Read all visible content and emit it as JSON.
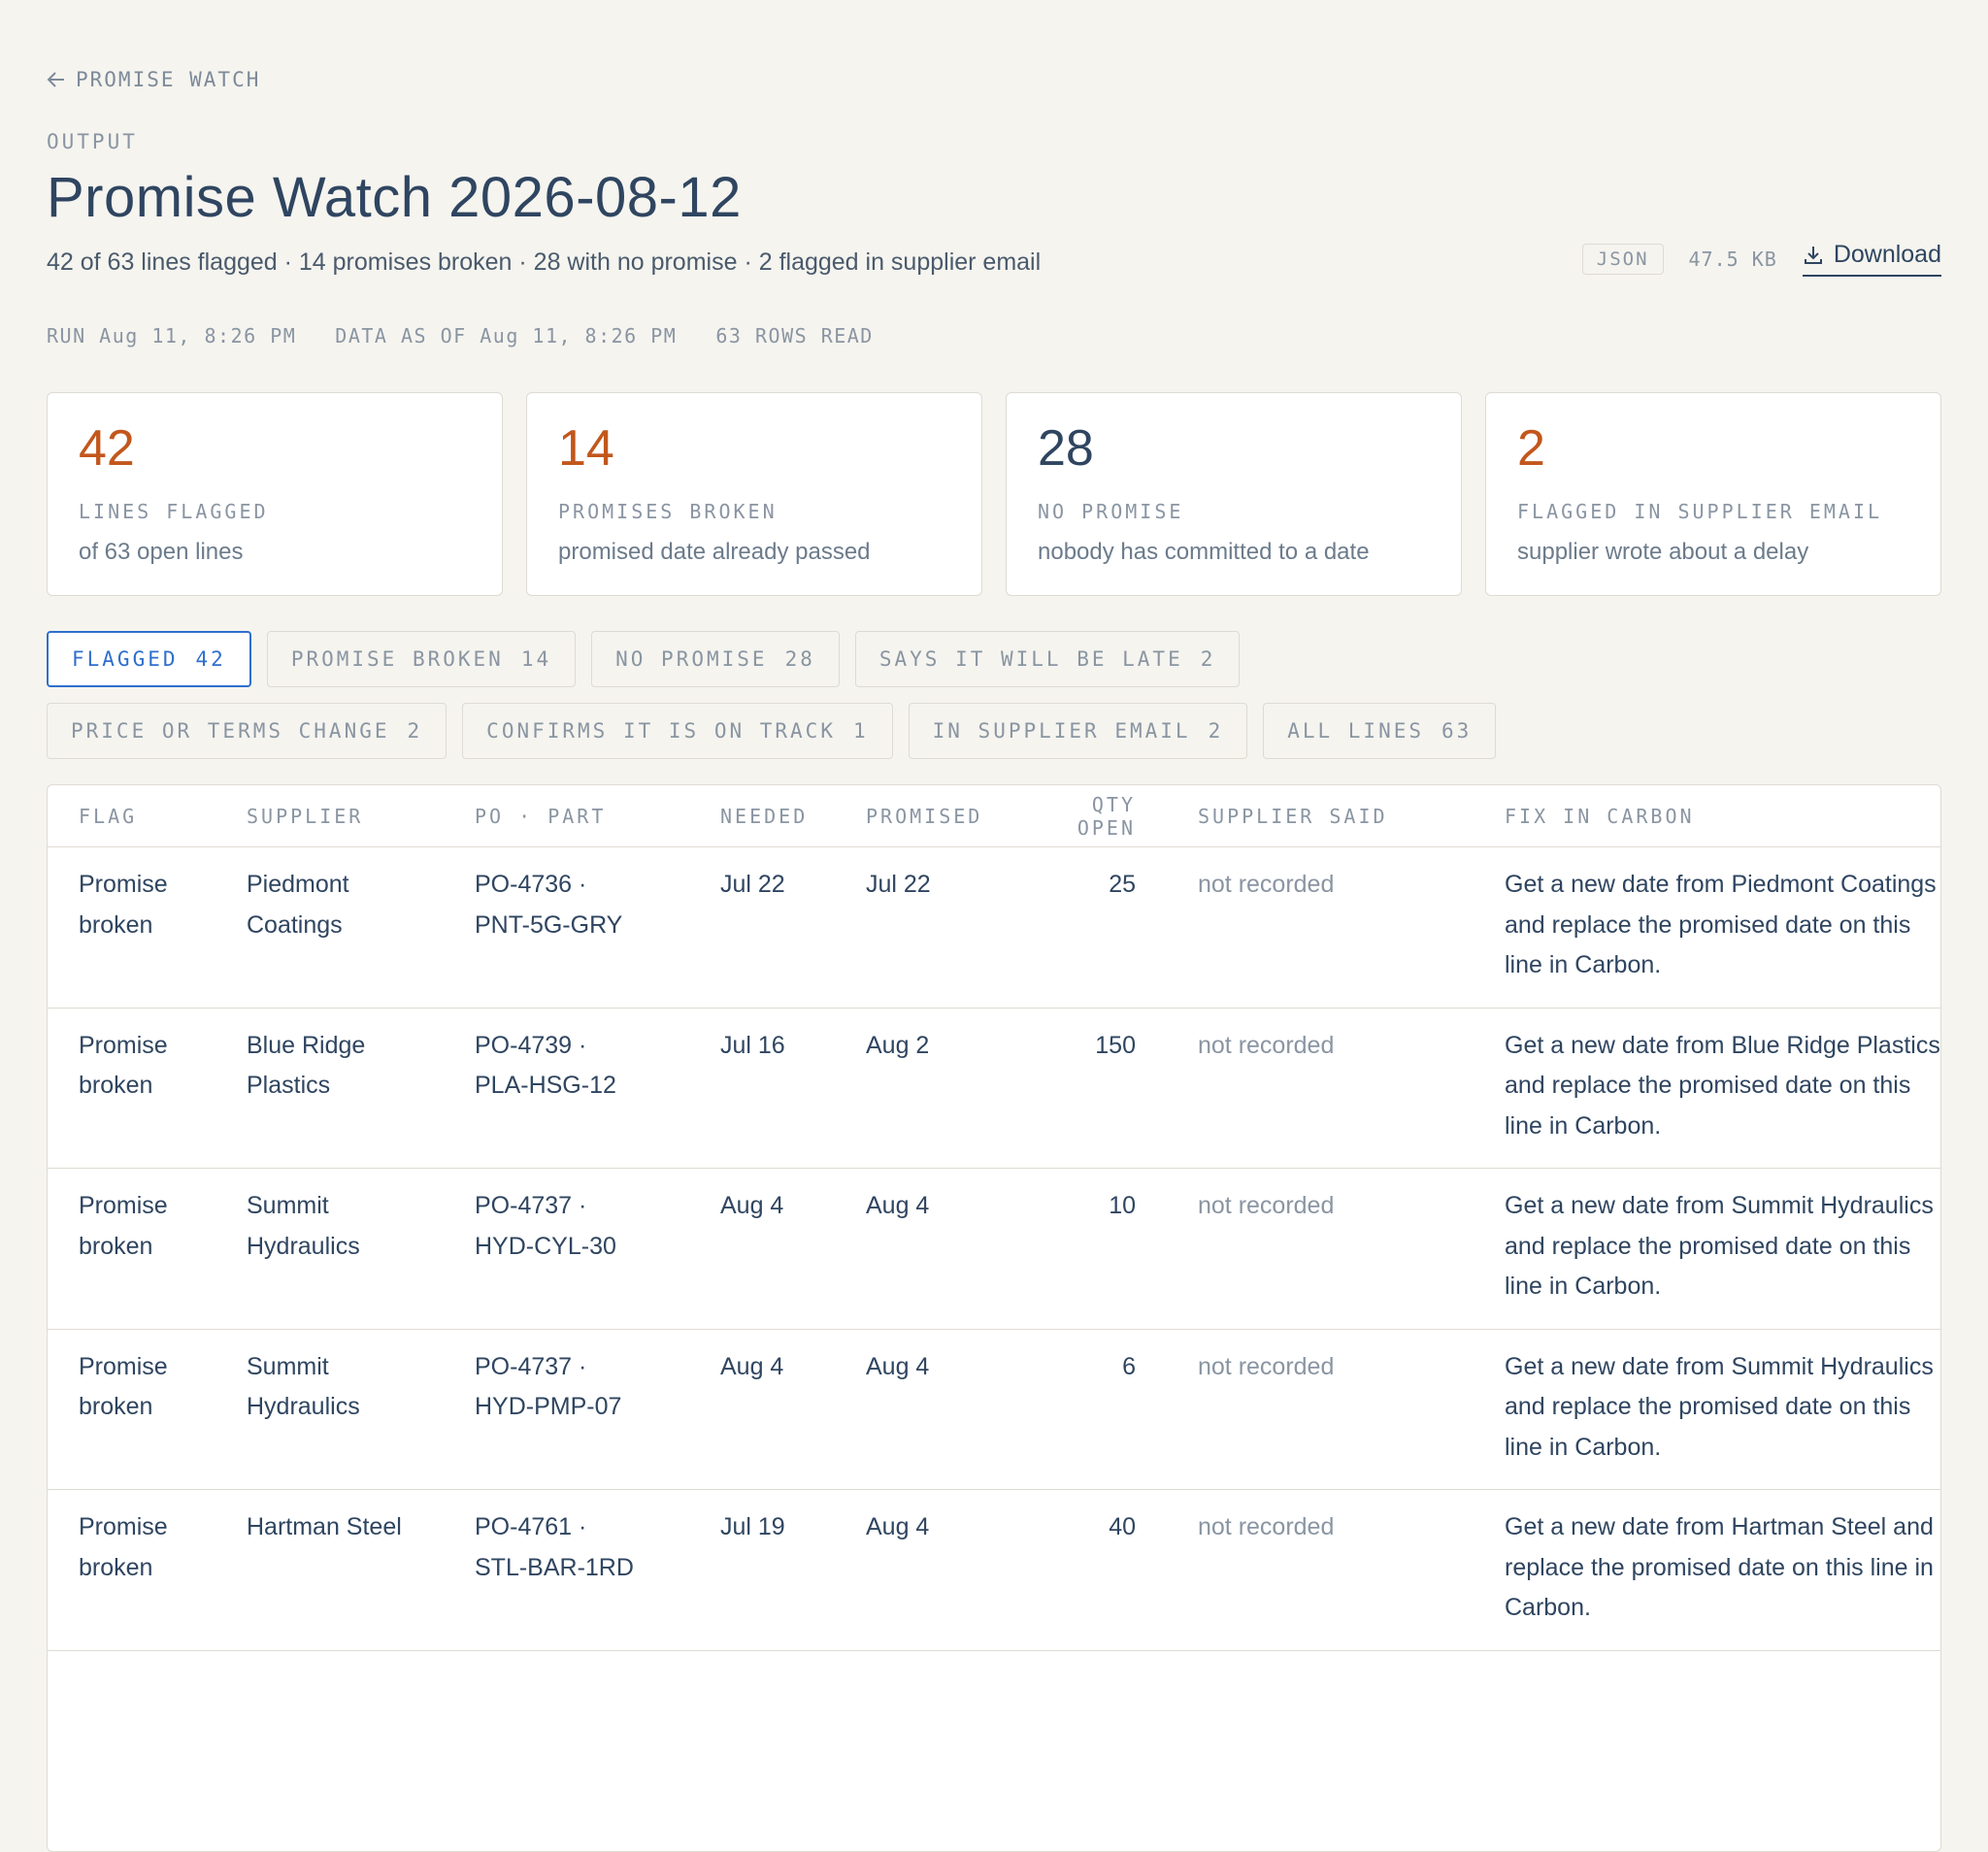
{
  "nav": {
    "back_label": "PROMISE WATCH"
  },
  "header": {
    "eyebrow": "OUTPUT",
    "title": "Promise Watch 2026-08-12",
    "summary": "42 of 63 lines flagged · 14 promises broken · 28 with no promise · 2 flagged in supplier email"
  },
  "file": {
    "format": "JSON",
    "size": "47.5 KB",
    "download_label": "Download"
  },
  "run_meta": {
    "run": "RUN Aug 11, 8:26 PM",
    "data_as_of": "DATA AS OF Aug 11, 8:26 PM",
    "rows_read": "63 ROWS READ"
  },
  "cards": [
    {
      "value": "42",
      "label": "LINES FLAGGED",
      "sub": "of 63 open lines",
      "color": "#c2571c"
    },
    {
      "value": "14",
      "label": "PROMISES BROKEN",
      "sub": "promised date already passed",
      "color": "#c2571c"
    },
    {
      "value": "28",
      "label": "NO PROMISE",
      "sub": "nobody has committed to a date",
      "color": "#2f4560"
    },
    {
      "value": "2",
      "label": "FLAGGED IN SUPPLIER EMAIL",
      "sub": "supplier wrote about a delay",
      "color": "#c2571c"
    }
  ],
  "filters": [
    {
      "label": "FLAGGED",
      "count": "42"
    },
    {
      "label": "PROMISE BROKEN",
      "count": "14"
    },
    {
      "label": "NO PROMISE",
      "count": "28"
    },
    {
      "label": "SAYS IT WILL BE LATE",
      "count": "2"
    },
    {
      "label": "PRICE OR TERMS CHANGE",
      "count": "2"
    },
    {
      "label": "CONFIRMS IT IS ON TRACK",
      "count": "1"
    },
    {
      "label": "IN SUPPLIER EMAIL",
      "count": "2"
    },
    {
      "label": "ALL LINES",
      "count": "63"
    }
  ],
  "active_filter": "FLAGGED",
  "table": {
    "columns": [
      "FLAG",
      "SUPPLIER",
      "PO · PART",
      "NEEDED",
      "PROMISED",
      "QTY OPEN",
      "SUPPLIER SAID",
      "FIX IN CARBON"
    ],
    "rows": [
      {
        "flag": "Promise broken",
        "supplier": "Piedmont Coatings",
        "po": "PO-4736 ·",
        "part": "PNT-5G-GRY",
        "needed": "Jul 22",
        "promised": "Jul 22",
        "qty": "25",
        "said": "not recorded",
        "fix": "Get a new date from Piedmont Coatings and replace the promised date on this line in Carbon."
      },
      {
        "flag": "Promise broken",
        "supplier": "Blue Ridge Plastics",
        "po": "PO-4739 ·",
        "part": "PLA-HSG-12",
        "needed": "Jul 16",
        "promised": "Aug 2",
        "qty": "150",
        "said": "not recorded",
        "fix": "Get a new date from Blue Ridge Plastics and replace the promised date on this line in Carbon."
      },
      {
        "flag": "Promise broken",
        "supplier": "Summit Hydraulics",
        "po": "PO-4737 ·",
        "part": "HYD-CYL-30",
        "needed": "Aug 4",
        "promised": "Aug 4",
        "qty": "10",
        "said": "not recorded",
        "fix": "Get a new date from Summit Hydraulics and replace the promised date on this line in Carbon."
      },
      {
        "flag": "Promise broken",
        "supplier": "Summit Hydraulics",
        "po": "PO-4737 ·",
        "part": "HYD-PMP-07",
        "needed": "Aug 4",
        "promised": "Aug 4",
        "qty": "6",
        "said": "not recorded",
        "fix": "Get a new date from Summit Hydraulics and replace the promised date on this line in Carbon."
      },
      {
        "flag": "Promise broken",
        "supplier": "Hartman Steel",
        "po": "PO-4761 ·",
        "part": "STL-BAR-1RD",
        "needed": "Jul 19",
        "promised": "Aug 4",
        "qty": "40",
        "said": "not recorded",
        "fix": "Get a new date from Hartman Steel and replace the promised date on this line in Carbon."
      }
    ]
  }
}
